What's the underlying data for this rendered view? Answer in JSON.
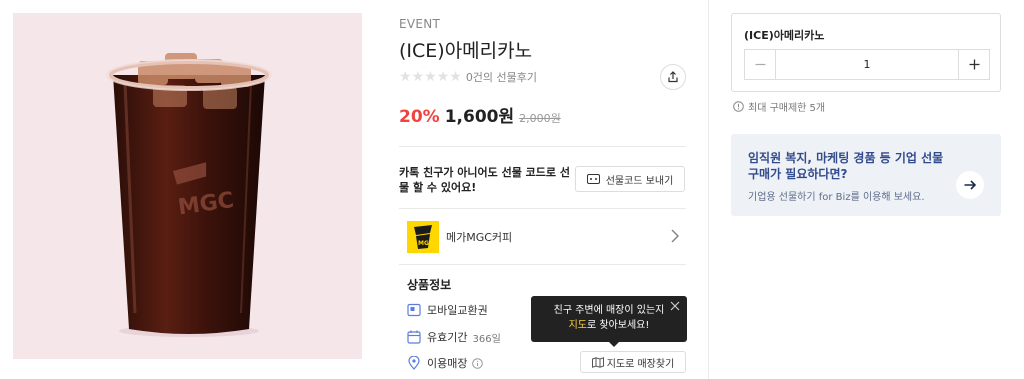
{
  "product": {
    "event_label": "EVENT",
    "title": "(ICE)아메리카노",
    "review_count_text": "0건의 선물후기",
    "rating": 0,
    "rating_max": 5,
    "discount": "20%",
    "price": "1,600원",
    "original_price": "2,000원"
  },
  "gift_code": {
    "text": "카톡 친구가 아니어도 선물 코드로 선물 할 수 있어요!",
    "button_label": "선물코드 보내기"
  },
  "brand": {
    "name": "메가MGC커피",
    "logo_text": "MGC"
  },
  "product_info": {
    "section_title": "상품정보",
    "items": [
      {
        "label": "모바일교환권",
        "value": "",
        "icon": "mobile-voucher-icon"
      },
      {
        "label": "유효기간",
        "value": "366일",
        "icon": "calendar-icon"
      },
      {
        "label": "이용매장",
        "value": "",
        "icon": "location-pin-icon"
      }
    ],
    "map_button_label": "지도로 매장찾기"
  },
  "tooltip": {
    "line1": "친구 주변에 매장이 있는지",
    "line2_highlight": "지도",
    "line2_rest": "로 찾아보세요!"
  },
  "option": {
    "title": "(ICE)아메리카노",
    "quantity": "1"
  },
  "purchase_limit": "최대 구매제한 5개",
  "biz_banner": {
    "title": "임직원 복지, 마케팅 경품 등 기업 선물 구매가 필요하다면?",
    "subtitle": "기업용 선물하기 for Biz를 이용해 보세요."
  },
  "colors": {
    "discount": "#f1423f",
    "image_bg": "#f5e6ea",
    "brand_yellow": "#fed600",
    "biz_bg": "#eef1f6",
    "biz_title": "#324b8c",
    "tooltip_bg": "#222222",
    "tooltip_highlight": "#ffd43b"
  }
}
